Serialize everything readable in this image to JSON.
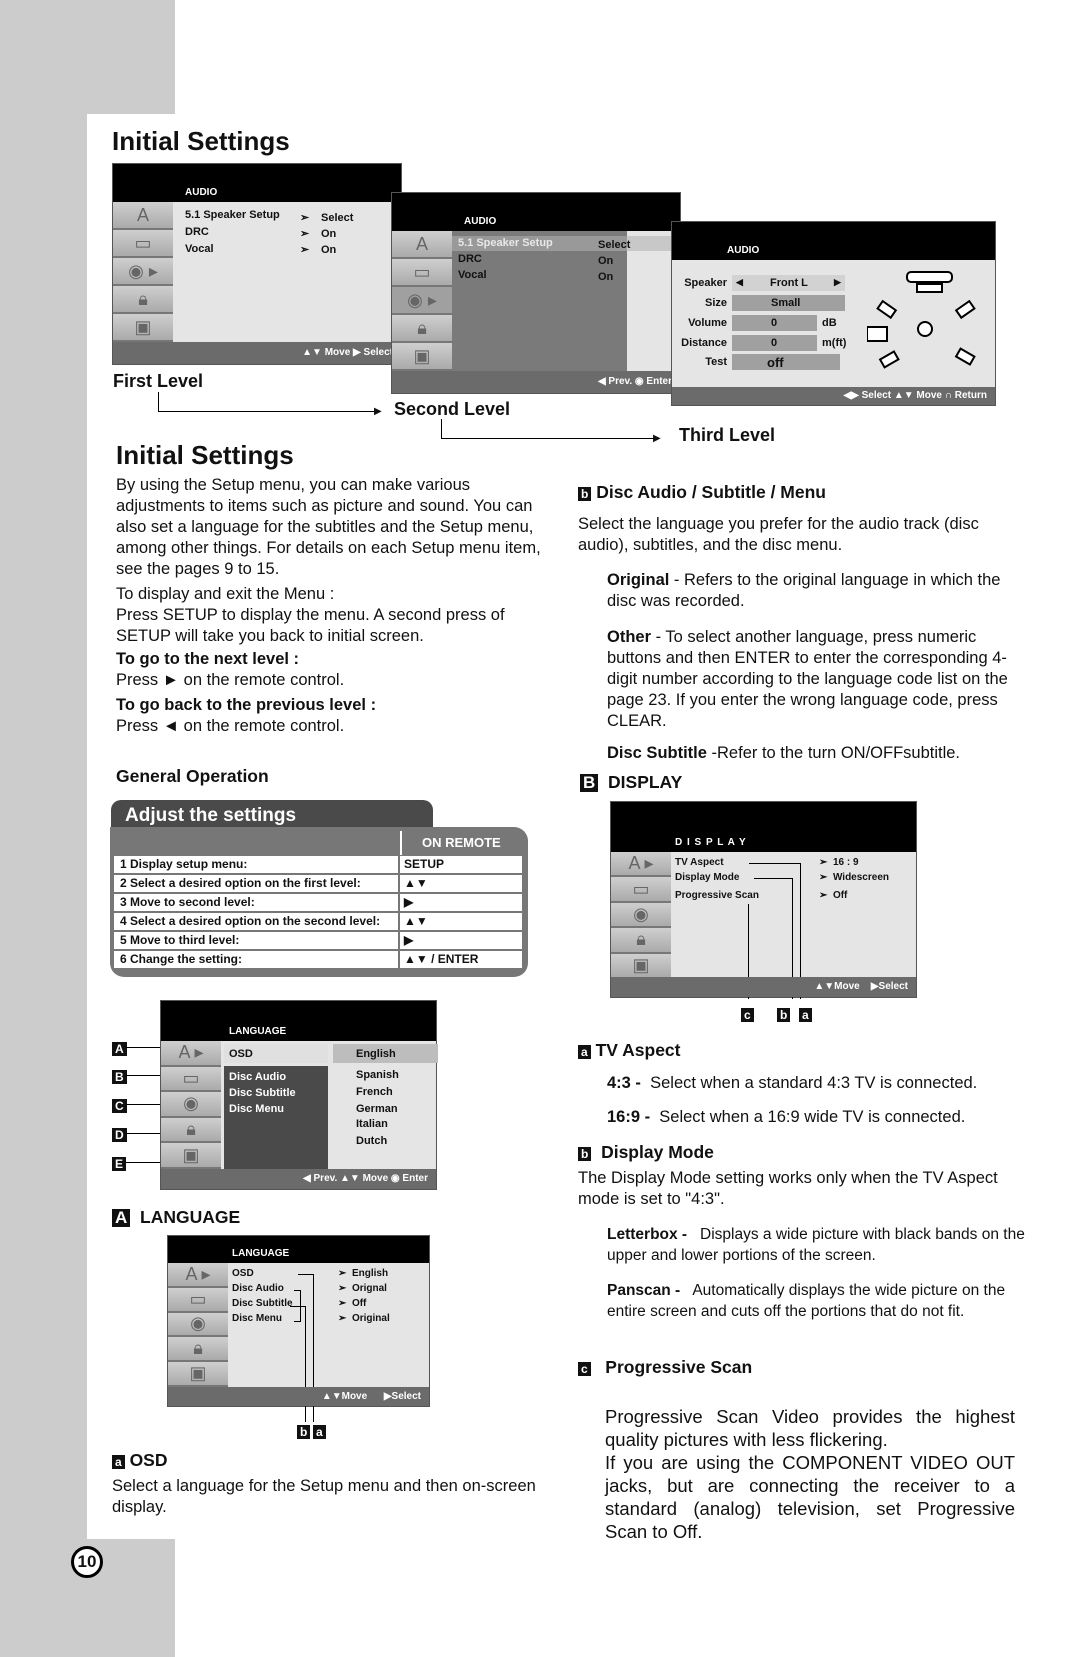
{
  "page": {
    "number": "10",
    "title_top": "Initial Settings",
    "levels": {
      "first": "First Level",
      "second": "Second Level",
      "third": "Third Level"
    }
  },
  "menu_first": {
    "header": "AUDIO",
    "items": [
      {
        "label": "5.1 Speaker Setup",
        "value": "Select"
      },
      {
        "label": "DRC",
        "value": "On"
      },
      {
        "label": "Vocal",
        "value": "On"
      }
    ],
    "footer": "▲▼ Move  ▶ Select",
    "arrow_icon": "➢"
  },
  "menu_second": {
    "header": "AUDIO",
    "items": [
      {
        "label": "5.1 Speaker Setup",
        "value": "Select"
      },
      {
        "label": "DRC",
        "value": "On"
      },
      {
        "label": "Vocal",
        "value": "On"
      }
    ],
    "footer": "◀ Prev.   ◉ Enter"
  },
  "menu_third": {
    "header": "AUDIO",
    "rows": [
      {
        "label": "Speaker",
        "value": "Front L",
        "unit": ""
      },
      {
        "label": "Size",
        "value": "Small",
        "unit": ""
      },
      {
        "label": "Volume",
        "value": "0",
        "unit": "dB"
      },
      {
        "label": "Distance",
        "value": "0",
        "unit": "m(ft)"
      },
      {
        "label": "Test",
        "value": "off",
        "unit": ""
      }
    ],
    "left_arrow": "◀",
    "right_arrow": "▶",
    "footer": "◀▶ Select    ▲▼ Move    ∩ Return"
  },
  "intro": {
    "title": "Initial Settings",
    "paragraph": "By using the Setup menu, you can make various adjustments to items such as picture and sound. You can also set a language for the subtitles and the Setup menu, among other things. For details on each Setup menu item, see the pages 9 to 15.",
    "display_exit_label": "To display and exit the Menu :",
    "display_exit_text": "Press SETUP to display the menu. A second press of SETUP will take you back to initial screen.",
    "next_level_label": "To go to the next level :",
    "next_level_text": "Press ► on the remote control.",
    "prev_level_label": "To go back to the previous level :",
    "prev_level_text": "Press ◄ on the remote control."
  },
  "general_operation": {
    "title": "General Operation",
    "tab_label": "Adjust the settings",
    "col_header": "ON REMOTE",
    "rows": [
      {
        "step": "1  Display setup menu:",
        "remote": "SETUP"
      },
      {
        "step": "2  Select a desired option on the first level:",
        "remote": "▲▼"
      },
      {
        "step": "3  Move to second level:",
        "remote": "▶"
      },
      {
        "step": "4  Select a desired option on the second level:",
        "remote": "▲▼"
      },
      {
        "step": "5  Move to third level:",
        "remote": "▶"
      },
      {
        "step": "6  Change the setting:",
        "remote": "▲▼ / ENTER"
      }
    ]
  },
  "language_menu": {
    "header": "LANGUAGE",
    "selected": "OSD",
    "items": [
      "Disc Audio",
      "Disc Subtitle",
      "Disc Menu"
    ],
    "options": [
      "English",
      "Spanish",
      "French",
      "German",
      "Italian",
      "Dutch"
    ],
    "footer": "◀ Prev.   ▲▼ Move   ◉ Enter",
    "callouts": [
      "A",
      "B",
      "C",
      "D",
      "E"
    ]
  },
  "section_language": {
    "mark": "A",
    "title": "LANGUAGE",
    "menu": {
      "header": "LANGUAGE",
      "items": [
        {
          "label": "OSD",
          "value": "English"
        },
        {
          "label": "Disc Audio",
          "value": "Orignal"
        },
        {
          "label": "Disc Subtitle",
          "value": "Off"
        },
        {
          "label": "Disc Menu",
          "value": "Original"
        }
      ],
      "footer_move": "▲▼Move",
      "footer_select": "▶Select",
      "callouts": [
        "b",
        "a"
      ]
    },
    "osd": {
      "mark": "a",
      "title": "OSD",
      "text": "Select a language for the Setup menu and then on-screen display."
    }
  },
  "section_disc": {
    "mark": "b",
    "title": "Disc Audio / Subtitle / Menu",
    "text": "Select the language you prefer for the audio track (disc audio), subtitles, and the disc menu.",
    "original_label": "Original",
    "original_text": " - Refers to the original language in which the disc was recorded.",
    "other_label": "Other",
    "other_text": " - To select another language, press numeric buttons and then ENTER to enter the corresponding 4-digit number according to the language code list on the page 23. If you enter the wrong language code, press CLEAR.",
    "subtitle_label": "Disc Subtitle",
    "subtitle_text": " -Refer to the turn ON/OFFsubtitle."
  },
  "section_display": {
    "mark": "B",
    "title": "DISPLAY",
    "menu": {
      "header": "D I S P L A Y",
      "items": [
        {
          "label": "TV Aspect",
          "value": "16 : 9"
        },
        {
          "label": "Display Mode",
          "value": "Widescreen"
        },
        {
          "label": "Progressive Scan",
          "value": "Off"
        }
      ],
      "footer_move": "▲▼Move",
      "footer_select": "▶Select",
      "callouts": [
        "c",
        "b",
        "a"
      ]
    },
    "tv_aspect": {
      "mark": "a",
      "title": "TV Aspect",
      "opt1_label": "4:3 -",
      "opt1_text": "Select when a standard 4:3 TV is connected.",
      "opt2_label": "16:9 -",
      "opt2_text": "Select when a 16:9 wide TV is connected."
    },
    "display_mode": {
      "mark": "b",
      "title": "Display Mode",
      "text": "The Display Mode setting works only when the TV Aspect mode is set to \"4:3\".",
      "letterbox_label": "Letterbox -",
      "letterbox_text": "Displays a wide picture with black bands on the upper and lower portions of the screen.",
      "panscan_label": "Panscan -",
      "panscan_text": "Automatically displays the wide picture on the entire screen and cuts off the portions that do not fit."
    },
    "progressive": {
      "mark": "c",
      "title": "Progressive Scan",
      "text1": "Progressive Scan Video provides the highest quality pictures with less flickering.",
      "text2": "If you are using the COMPONENT VIDEO OUT jacks, but are connecting the receiver to a standard (analog) television, set Progressive Scan to Off."
    }
  }
}
